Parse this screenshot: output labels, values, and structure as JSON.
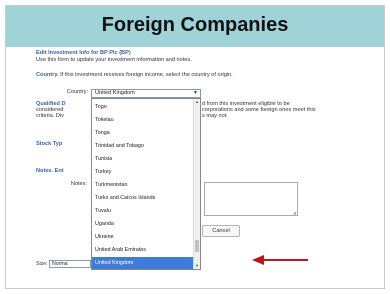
{
  "slide": {
    "title": "Foreign Companies"
  },
  "form": {
    "heading": "Edit Investment Info for BP Plc (BP)",
    "subheading": "Use this form to update your investment information and notes.",
    "country_label": "Country.",
    "country_help": "If this investment receives foreign income, select the country of origin.",
    "country_field_label": "Country:",
    "country_selected": "United Kingdom",
    "qualified_label_visible": "Qualified D",
    "qualified_line1_visible": "considered",
    "qualified_line2_visible": "criteria. Div",
    "qualified_right_line1": "d from this investment eligible to be",
    "qualified_right_line2": "corporations and some foreign ones meet this",
    "qualified_right_line3": "s may not.",
    "stock_type_visible": "Stock Typ",
    "notes_heading_visible": "Notes. Ent",
    "notes_field_label": "Notes:",
    "cancel_label": "Cancel",
    "size_label": "Size:",
    "size_value_visible": "Norma"
  },
  "dropdown": {
    "items": [
      "Togo",
      "Tokelau",
      "Tonga",
      "Trinidad and Tobago",
      "Tunisia",
      "Turkey",
      "Turkmenistan",
      "Turks and Caicos Islands",
      "Tuvalu",
      "Uganda",
      "Ukraine",
      "United Arab Emirates",
      "United Kingdom"
    ],
    "selected": "United Kingdom"
  },
  "colors": {
    "header_band": "#9fd3d8",
    "arrow": "#c0141c",
    "selection": "#3f7cd9",
    "link_blue": "#3b64a3"
  }
}
